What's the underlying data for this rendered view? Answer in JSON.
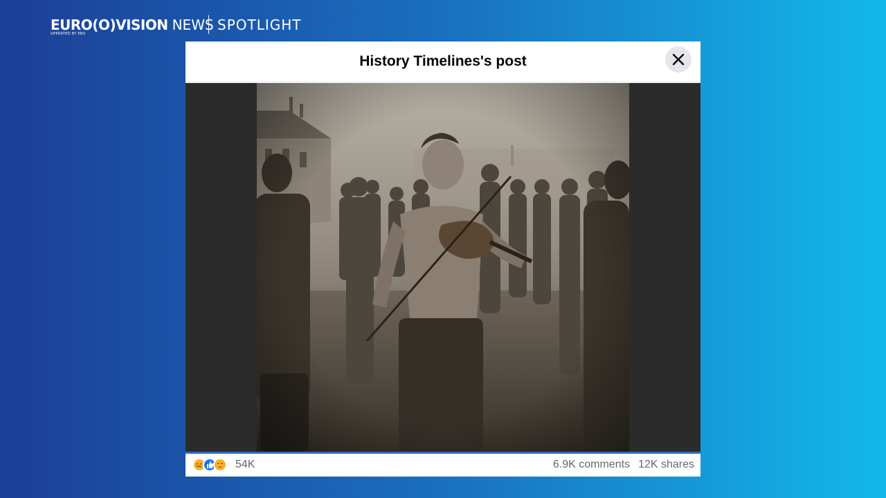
{
  "brand": {
    "logo_text": "EURO(O)VISION",
    "news_text": "NEWS",
    "operated_text": "OPERATED BY EBU",
    "section_text": "SPOTLIGHT"
  },
  "modal": {
    "title": "History Timelines's post",
    "close_icon": "close-icon",
    "photo": {
      "description_icon": "photo",
      "tone": "sepia"
    },
    "footer": {
      "reaction_icons": [
        "sad-reaction-icon",
        "like-reaction-icon",
        "care-reaction-icon"
      ],
      "reaction_count": "54K",
      "comments": "6.9K comments",
      "shares": "12K shares"
    }
  },
  "colors": {
    "background_start": "#1b3f96",
    "background_end": "#12b8ea",
    "accent_line": "#2d6dbb",
    "muted_text": "#65676b"
  }
}
